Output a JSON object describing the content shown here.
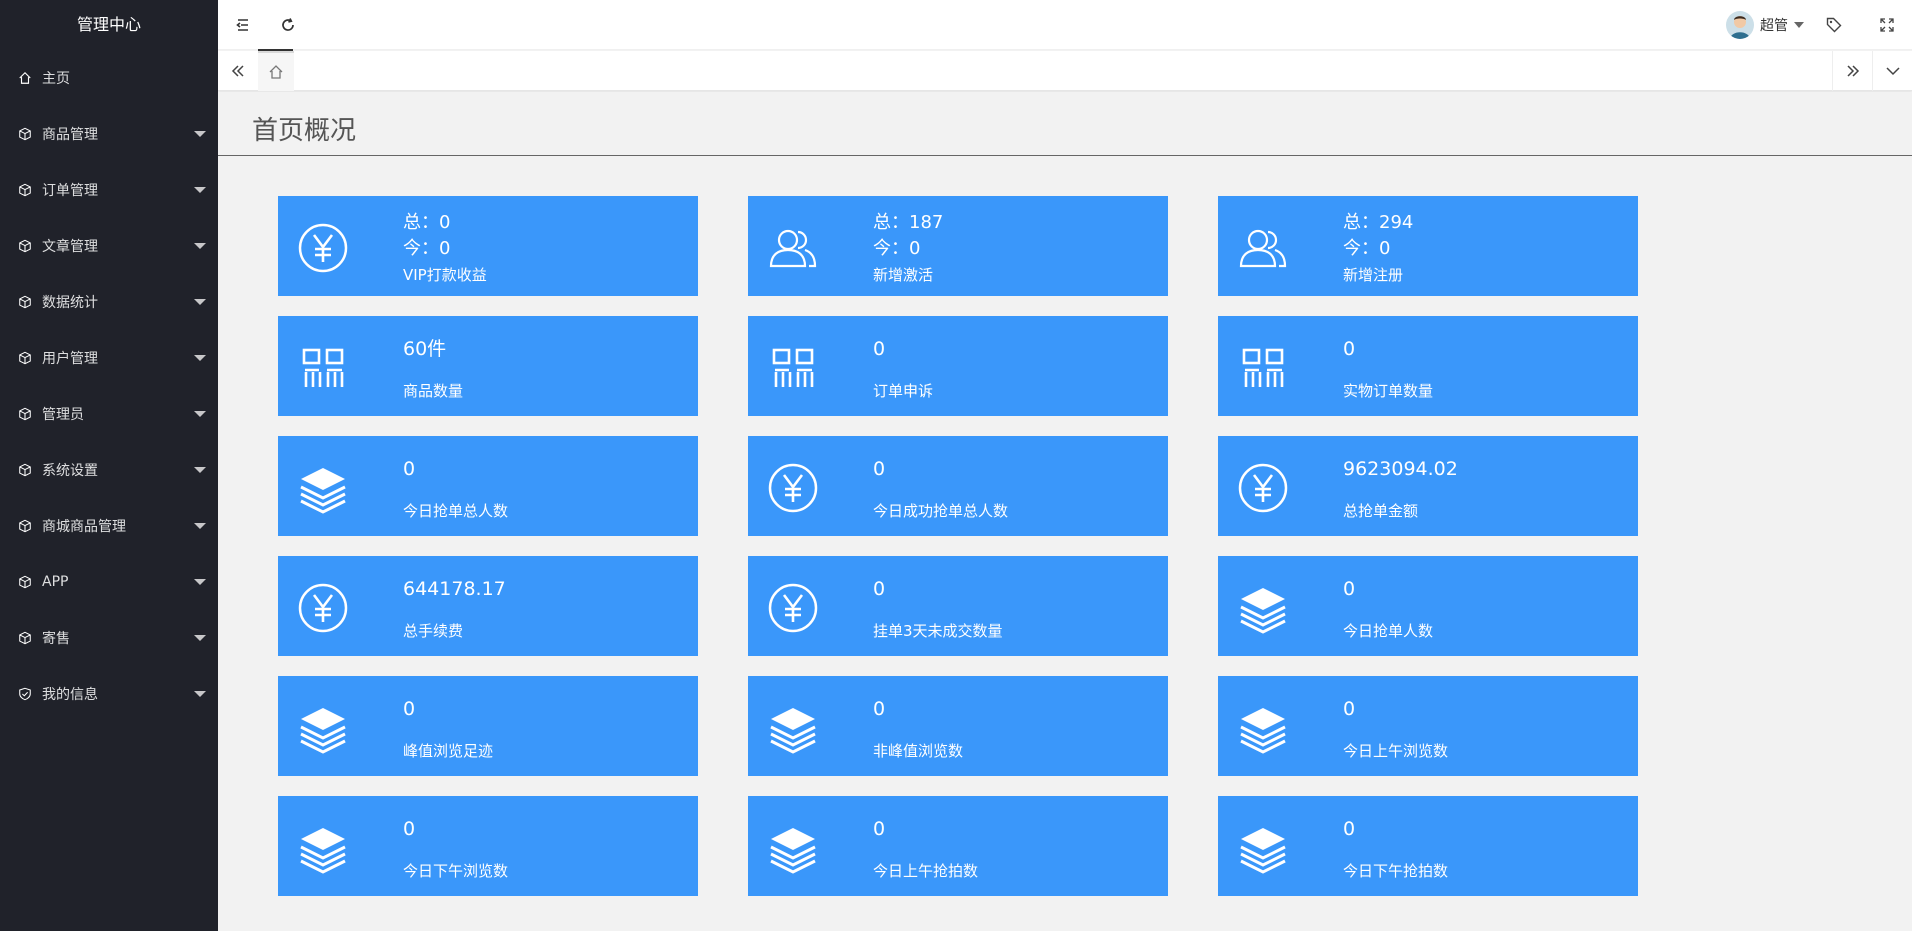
{
  "sidebar": {
    "brand": "管理中心",
    "items": [
      {
        "label": "主页"
      },
      {
        "label": "商品管理"
      },
      {
        "label": "订单管理"
      },
      {
        "label": "文章管理"
      },
      {
        "label": "数据统计"
      },
      {
        "label": "用户管理"
      },
      {
        "label": "管理员"
      },
      {
        "label": "系统设置"
      },
      {
        "label": "商城商品管理"
      },
      {
        "label": "APP"
      },
      {
        "label": "寄售"
      },
      {
        "label": "我的信息"
      }
    ]
  },
  "header": {
    "user_name": "超管"
  },
  "page": {
    "title": "首页概况"
  },
  "cards": [
    {
      "icon": "yen-icon",
      "total_label": "总：",
      "total": "0",
      "today_label": "今：",
      "today": "0",
      "label": "VIP打款收益"
    },
    {
      "icon": "users-icon",
      "total_label": "总：",
      "total": "187",
      "today_label": "今：",
      "today": "0",
      "label": "新增激活"
    },
    {
      "icon": "users-icon",
      "total_label": "总：",
      "total": "294",
      "today_label": "今：",
      "today": "0",
      "label": "新增注册"
    },
    {
      "icon": "qrcode-icon",
      "value": "60件",
      "label": "商品数量"
    },
    {
      "icon": "qrcode-icon",
      "value": "0",
      "label": "订单申诉"
    },
    {
      "icon": "qrcode-icon",
      "value": "0",
      "label": "实物订单数量"
    },
    {
      "icon": "layers-icon",
      "value": "0",
      "label": "今日抢单总人数"
    },
    {
      "icon": "yen-icon",
      "value": "0",
      "label": "今日成功抢单总人数"
    },
    {
      "icon": "yen-icon",
      "value": "9623094.02",
      "label": "总抢单金额"
    },
    {
      "icon": "yen-icon",
      "value": "644178.17",
      "label": "总手续费"
    },
    {
      "icon": "yen-icon",
      "value": "0",
      "label": "挂单3天未成交数量"
    },
    {
      "icon": "layers-icon",
      "value": "0",
      "label": "今日抢单人数"
    },
    {
      "icon": "layers-icon",
      "value": "0",
      "label": "峰值浏览足迹"
    },
    {
      "icon": "layers-icon",
      "value": "0",
      "label": "非峰值浏览数"
    },
    {
      "icon": "layers-icon",
      "value": "0",
      "label": "今日上午浏览数"
    },
    {
      "icon": "layers-icon",
      "value": "0",
      "label": "今日下午浏览数"
    },
    {
      "icon": "layers-icon",
      "value": "0",
      "label": "今日上午抢拍数"
    },
    {
      "icon": "layers-icon",
      "value": "0",
      "label": "今日下午抢拍数"
    }
  ],
  "colors": {
    "sidebar_bg": "#20222a",
    "card_bg": "#3a97fa"
  }
}
